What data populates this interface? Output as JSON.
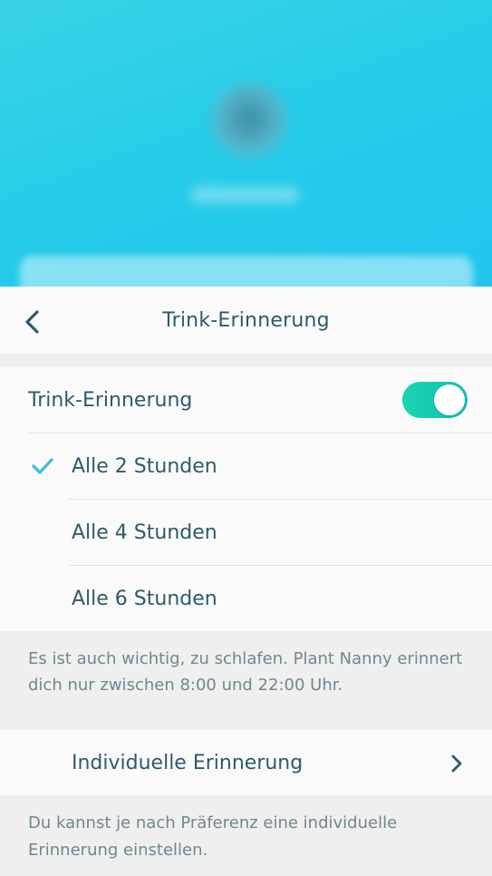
{
  "header": {
    "title": "Trink-Erinnerung"
  },
  "reminder": {
    "toggle_label": "Trink-Erinnerung",
    "toggle_on": true,
    "accent_color": "#1ad3b2",
    "options": [
      {
        "label": "Alle 2 Stunden",
        "selected": true
      },
      {
        "label": "Alle 4 Stunden",
        "selected": false
      },
      {
        "label": "Alle 6 Stunden",
        "selected": false
      }
    ],
    "note": "Es ist auch wichtig, zu schlafen. Plant Nanny erinnert dich nur zwischen 8:00 und 22:00 Uhr."
  },
  "custom": {
    "label": "Individuelle Erinnerung",
    "note": "Du kannst je nach Präferenz eine individuelle Erinnerung einstellen."
  },
  "icons": {
    "back": "chevron-left-icon",
    "check": "checkmark-icon",
    "forward": "chevron-right-icon"
  }
}
